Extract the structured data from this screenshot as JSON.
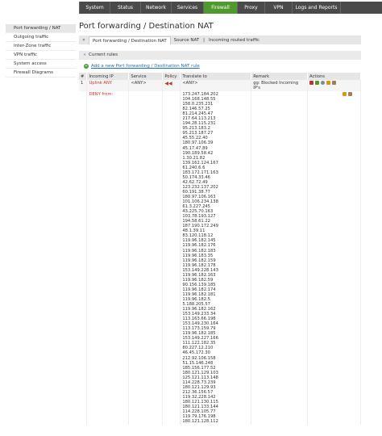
{
  "menu": {
    "items": [
      {
        "label": "System",
        "w": 38
      },
      {
        "label": "Status",
        "w": 38
      },
      {
        "label": "Network",
        "w": 38
      },
      {
        "label": "Services",
        "w": 40
      },
      {
        "label": "Firewall",
        "w": 42
      },
      {
        "label": "Proxy",
        "w": 34
      },
      {
        "label": "VPN",
        "w": 34
      },
      {
        "label": "Logs and Reports",
        "w": 60
      }
    ],
    "active": "Firewall"
  },
  "sidebar": {
    "items": [
      {
        "label": "Port forwarding / NAT",
        "active": true
      },
      {
        "label": "Outgoing traffic",
        "active": false
      },
      {
        "label": "Inter-Zone traffic",
        "active": false
      },
      {
        "label": "VPN traffic",
        "active": false
      },
      {
        "label": "System access",
        "active": false
      },
      {
        "label": "Firewall Diagrams",
        "active": false
      }
    ]
  },
  "page": {
    "title": "Port forwarding / Destination NAT",
    "tabs": [
      {
        "label": "Port forwarding / Destination NAT",
        "active": true
      },
      {
        "label": "Source NAT",
        "active": false
      },
      {
        "label": "Incoming routed traffic",
        "active": false
      }
    ],
    "tab_arrow": "«",
    "tab_separator": "|"
  },
  "section": {
    "title": "Current rules",
    "add_link": "Add a new Port forwarding / Destination NAT rule"
  },
  "table": {
    "headers": [
      "#",
      "Incoming IP",
      "Service",
      "Policy",
      "Translate to",
      "Remark",
      "Actions"
    ],
    "rule": {
      "num": "1",
      "incoming_ip": "Uplink ANY",
      "service": "<ANY>",
      "translate_to": "<ANY>",
      "remark": "gg: Blocked Incoming IP's",
      "deny_label": "DENY from:"
    },
    "ip_list": [
      "173.247.184.202",
      "104.168.148.55",
      "158.0.235.231",
      "82.146.57.25",
      "81.214.245.47",
      "217.64.113.213",
      "194.28.115.231",
      "95.213.183.2",
      "95.213.187.27",
      "45.55.22.40",
      "180.97.106.39",
      "45.17.47.89",
      "190.189.58.42",
      "1.30.21.82",
      "139.162.124.167",
      "61.240.6.6",
      "183.172.171.163",
      "50.174.33.46",
      "42.62.72.49",
      "123.232.137.202",
      "60.191.38.77",
      "180.97.106.163",
      "101.106.234.138",
      "61.3.227.245",
      "43.225.70.163",
      "103.78.193.127",
      "194.58.61.22",
      "187.190.172.249",
      "48.1.39.11",
      "83.120.118.12",
      "119.96.182.145",
      "119.96.182.176",
      "119.96.182.183",
      "119.96.183.35",
      "119.96.182.159",
      "119.96.182.178",
      "153.149.228.143",
      "119.96.182.163",
      "119.96.182.59",
      "90.156.139.185",
      "119.96.182.174",
      "119.96.182.181",
      "119.96.182.5",
      "5.188.205.57",
      "119.96.182.162",
      "153.149.233.34",
      "113.163.66.198",
      "153.149.230.164",
      "113.173.159.79",
      "119.96.182.185",
      "153.149.227.166",
      "111.122.182.35",
      "80.227.12.210",
      "46.45.172.30",
      "212.92.106.158",
      "51.15.146.248",
      "185.156.177.52",
      "180.121.129.103",
      "125.121.113.148",
      "114.228.73.239",
      "180.121.129.93",
      "212.36.156.57",
      "119.32.228.142",
      "180.121.130.115",
      "180.121.133.144",
      "114.228.105.77",
      "119.79.176.198",
      "180.121.128.112"
    ],
    "ip_shown_count": 68
  }
}
